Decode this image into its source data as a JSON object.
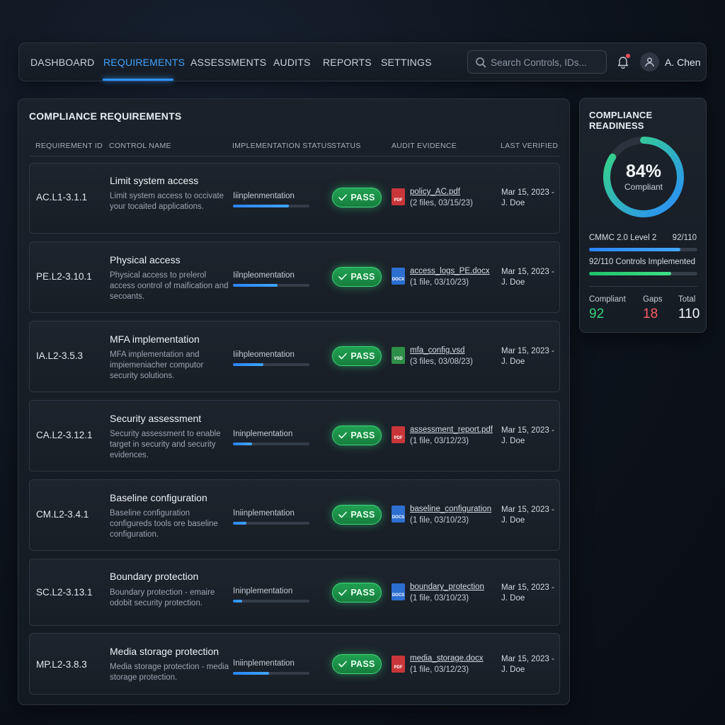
{
  "nav": {
    "items": [
      "DASHBOARD",
      "REQUIREMENTS",
      "ASSESSMENTS",
      "AUDITS",
      "REPORTS",
      "SETTINGS"
    ],
    "active": "REQUIREMENTS",
    "search_placeholder": "Search Controls, IDs...",
    "user_name": "A. Chen",
    "accent_color": "#2f93ff"
  },
  "main": {
    "title": "COMPLIANCE REQUIREMENTS",
    "columns": [
      "REQUIREMENT ID",
      "CONTROL NAME",
      "IMPLEMENTATION STATUS",
      "STATUS",
      "AUDIT EVIDENCE",
      "LAST VERIFIED"
    ],
    "rows": [
      {
        "id": "AC.L1-3.1.1",
        "name": "Limit system access",
        "description": "Limit system access to occivate your tocaited applications.",
        "impl_label": "Iiinplenmentation",
        "impl_progress": 0.73,
        "status": "PASS",
        "file_type": "PDF",
        "file_name": "policy_AC.pdf",
        "file_meta": "(2 files, 03/15/23)",
        "verified_date": "Mar 15, 2023 -",
        "verified_by": "J. Doe"
      },
      {
        "id": "PE.L2-3.10.1",
        "name": "Physical access",
        "description": "Physical access to prelerol access oontrol of maification and secoants.",
        "impl_label": "Iilnpleomentation",
        "impl_progress": 0.58,
        "status": "PASS",
        "file_type": "DOCX",
        "file_name": "access_logs_PE.docx",
        "file_meta": "(1 file, 03/10/23)",
        "verified_date": "Mar 15, 2023 -",
        "verified_by": "J. Doe"
      },
      {
        "id": "IA.L2-3.5.3",
        "name": "MFA implementation",
        "description": "MFA implementation and impiemeniacher computor security solutions.",
        "impl_label": "Iiihpleomentation",
        "impl_progress": 0.4,
        "status": "PASS",
        "file_type": "VSD",
        "file_name": "mfa_config.vsd",
        "file_meta": "(3 files, 03/08/23)",
        "verified_date": "Mar 15, 2023 -",
        "verified_by": "J. Doe"
      },
      {
        "id": "CA.L2-3.12.1",
        "name": "Security assessment",
        "description": "Security assessment to enable target in security and security evidences.",
        "impl_label": "Ininplementation",
        "impl_progress": 0.25,
        "status": "PASS",
        "file_type": "PDF",
        "file_name": "assessment_report.pdf",
        "file_meta": "(1 file, 03/12/23)",
        "verified_date": "Mar 15, 2023 -",
        "verified_by": "J. Doe"
      },
      {
        "id": "CM.L2-3.4.1",
        "name": "Baseline configuration",
        "description": "Baseline configuration configureds tools ore baseline configuration.",
        "impl_label": "Iniinplementation",
        "impl_progress": 0.18,
        "status": "PASS",
        "file_type": "DOCS",
        "file_name": "baseline_configuration",
        "file_meta": "(1 file, 03/10/23)",
        "verified_date": "Mar 15, 2023 -",
        "verified_by": "J. Doe"
      },
      {
        "id": "SC.L2-3.13.1",
        "name": "Boundary protection",
        "description": "Boundary protection - emaire odobit security protection.",
        "impl_label": "Ininplementation",
        "impl_progress": 0.12,
        "status": "PASS",
        "file_type": "DOCS",
        "file_name": "boundary_protection",
        "file_meta": "(1 file, 03/10/23)",
        "verified_date": "Mar 15, 2023 -",
        "verified_by": "J. Doe"
      },
      {
        "id": "MP.L2-3.8.3",
        "name": "Media storage protection",
        "description": "Media storage protection - media storage protection.",
        "impl_label": "Iniinplementation",
        "impl_progress": 0.47,
        "status": "PASS",
        "file_type": "PDF",
        "file_name": "media_storage.docx",
        "file_meta": "(1 file, 03/12/23)",
        "verified_date": "Mar 15, 2023 -",
        "verified_by": "J. Doe"
      }
    ]
  },
  "readiness": {
    "title": "COMPLIANCE READINESS",
    "percent": 84,
    "percent_label": "84%",
    "sub_label": "Compliant",
    "level_label": "CMMC 2.0 Level 2",
    "level_count": "92/110",
    "level_progress": 0.84,
    "implemented_label": "92/110 Controls Implemented",
    "implemented_progress": 0.76,
    "stats": [
      {
        "label": "Compliant",
        "value": "92",
        "color": "#34d27a"
      },
      {
        "label": "Gaps",
        "value": "18",
        "color": "#ff5a62"
      },
      {
        "label": "Total",
        "value": "110",
        "color": "#f2f5f9"
      }
    ]
  }
}
